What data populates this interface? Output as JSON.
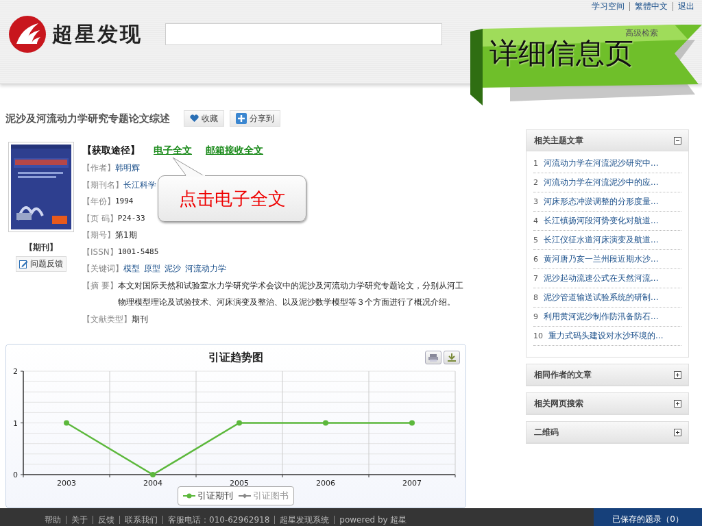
{
  "top_links": [
    "学习空间",
    "繁體中文",
    "退出"
  ],
  "logo": {
    "text": "超星发现"
  },
  "search": {
    "advanced_link": "高级检索"
  },
  "ribbon": {
    "text": "详细信息页"
  },
  "article": {
    "title": "泥沙及河流动力学研究专题论文综述",
    "actions": [
      {
        "kind": "favorite",
        "label": "收藏"
      },
      {
        "kind": "share",
        "label": "分享到"
      }
    ],
    "type_label": "【期刊】",
    "feedback": "问题反馈",
    "access": {
      "label": "【获取途径】",
      "links": [
        "电子全文",
        "邮箱接收全文"
      ]
    },
    "fields": [
      {
        "label": "【作者】",
        "kind": "link",
        "value": "韩明辉"
      },
      {
        "label": "【期刊名】",
        "kind": "link",
        "value": "长江科学"
      },
      {
        "label": "【年份】",
        "kind": "mono",
        "value": "1994"
      },
      {
        "label": "【页 码】",
        "kind": "mono",
        "value": "P24-33"
      },
      {
        "label": "【期号】",
        "kind": "text",
        "value": "第1期"
      },
      {
        "label": "【ISSN】",
        "kind": "mono",
        "value": "1001-5485"
      },
      {
        "label": "【关键词】",
        "kind": "links",
        "values": [
          "模型",
          "原型",
          "泥沙",
          "河流动力学"
        ]
      },
      {
        "label": "【摘 要】",
        "kind": "text",
        "value": "本文对国际天然和试验室水力学研究学术会议中的泥沙及河流动力学研究专题论文，分别从河工物理模型理论及试验技术、河床演变及整治、以及泥沙数学模型等３个方面进行了概况介绍。"
      },
      {
        "label": "【文献类型】",
        "kind": "text",
        "value": "期刊"
      }
    ]
  },
  "callout": {
    "text": "点击电子全文"
  },
  "chart": {
    "chart_data": {
      "type": "line",
      "title": "引证趋势图",
      "categories": [
        "2003",
        "2004",
        "2005",
        "2006",
        "2007"
      ],
      "ylim": [
        0,
        2
      ],
      "yticks": [
        0,
        1,
        2
      ],
      "series": [
        {
          "name": "引证期刊",
          "color": "#5cb83c",
          "marker": "circle",
          "values": [
            1,
            0,
            1,
            1,
            1
          ]
        }
      ]
    },
    "hidden_legend": [
      {
        "label": "引证图书",
        "color": "#888888"
      }
    ]
  },
  "side_panels": [
    {
      "title": "相关主题文章",
      "expanded": true,
      "items": [
        {
          "number": "1",
          "title": "河流动力学在河流泥沙研究中..."
        },
        {
          "number": "2",
          "title": "河流动力学在河流泥沙中的应..."
        },
        {
          "number": "3",
          "title": "河床形态冲淤调整的分形度量..."
        },
        {
          "number": "4",
          "title": "长江镇扬河段河势变化对航道..."
        },
        {
          "number": "5",
          "title": "长江仪征水道河床演变及航道..."
        },
        {
          "number": "6",
          "title": "黄河唐乃亥一兰州段近期水沙..."
        },
        {
          "number": "7",
          "title": "泥沙起动流速公式在天然河流..."
        },
        {
          "number": "8",
          "title": "泥沙管道输送试验系统的研制..."
        },
        {
          "number": "9",
          "title": "利用黄河泥沙制作防汛备防石..."
        },
        {
          "number": "10",
          "title": "重力式码头建设对水沙环境的..."
        }
      ]
    },
    {
      "title": "相同作者的文章",
      "expanded": false
    },
    {
      "title": "相关网页搜索",
      "expanded": false
    },
    {
      "title": "二维码",
      "expanded": false
    }
  ],
  "footer": {
    "links": [
      "帮助",
      "关于",
      "反馈",
      "联系我们",
      "客服电话：010-62962918",
      "超星发现系统",
      "powered by 超星"
    ],
    "saved": "已保存的题录（0）"
  }
}
